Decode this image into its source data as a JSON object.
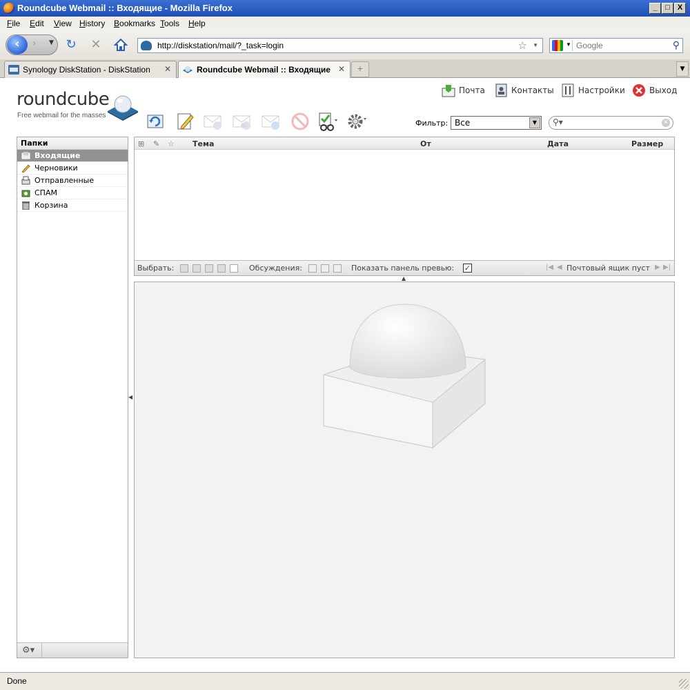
{
  "window": {
    "title": "Roundcube Webmail :: Входящие - Mozilla Firefox",
    "minimize": "_",
    "maximize": "□",
    "close": "X"
  },
  "menubar": [
    "File",
    "Edit",
    "View",
    "History",
    "Bookmarks",
    "Tools",
    "Help"
  ],
  "navigation": {
    "url": "http://diskstation/mail/?_task=login",
    "search_placeholder": "Google"
  },
  "tabs": [
    {
      "label": "Synology DiskStation - DiskStation",
      "icon": "dsm-icon",
      "active": false
    },
    {
      "label": "Roundcube Webmail :: Входящие",
      "icon": "roundcube-icon",
      "active": true
    }
  ],
  "app": {
    "logo_text": "roundcube",
    "tagline": "Free webmail for the masses",
    "top_nav": [
      {
        "label": "Почта",
        "icon": "mail-icon"
      },
      {
        "label": "Контакты",
        "icon": "contacts-icon"
      },
      {
        "label": "Настройки",
        "icon": "settings-icon"
      },
      {
        "label": "Выход",
        "icon": "logout-icon"
      }
    ],
    "toolbar": [
      "check-mail-icon",
      "compose-icon",
      "reply-icon",
      "reply-all-icon",
      "forward-icon",
      "delete-icon",
      "mark-icon",
      "more-icon"
    ],
    "filter": {
      "label": "Фильтр:",
      "value": "Все"
    },
    "folders": {
      "header": "Папки",
      "items": [
        {
          "label": "Входящие",
          "icon": "inbox-icon",
          "selected": true
        },
        {
          "label": "Черновики",
          "icon": "drafts-icon",
          "selected": false
        },
        {
          "label": "Отправленные",
          "icon": "sent-icon",
          "selected": false
        },
        {
          "label": "СПАМ",
          "icon": "spam-icon",
          "selected": false
        },
        {
          "label": "Корзина",
          "icon": "trash-icon",
          "selected": false
        }
      ]
    },
    "message_list": {
      "columns": [
        "Тема",
        "От",
        "Дата",
        "Размер"
      ],
      "footer": {
        "select_label": "Выбрать:",
        "threads_label": "Обсуждения:",
        "preview_label": "Показать панель превью:",
        "preview_checked": true,
        "checkbox_mark": "✓",
        "status": "Почтовый ящик пуст"
      }
    }
  },
  "status": "Done"
}
